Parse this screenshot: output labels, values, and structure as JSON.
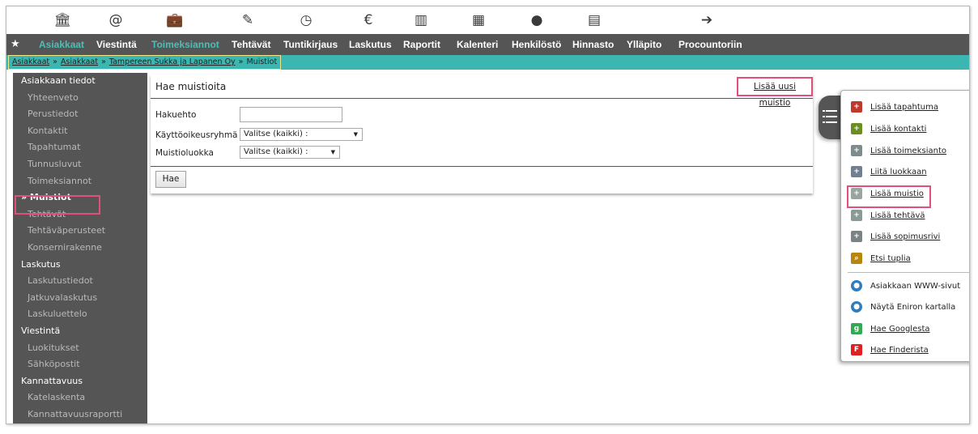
{
  "colors": {
    "accent": "#3cb6b0",
    "nav_bg": "#555555",
    "highlight_box": "#e0507a"
  },
  "icon_bar": [
    {
      "name": "bank-icon",
      "glyph": "🏛"
    },
    {
      "name": "at-icon",
      "glyph": "@"
    },
    {
      "name": "briefcase-icon",
      "glyph": "💼"
    },
    {
      "name": "edit-icon",
      "glyph": "✎"
    },
    {
      "name": "clock-icon",
      "glyph": "◷"
    },
    {
      "name": "euro-icon",
      "glyph": "€"
    },
    {
      "name": "bar-chart-icon",
      "glyph": "▥"
    },
    {
      "name": "calendar-icon",
      "glyph": "▦"
    },
    {
      "name": "person-icon",
      "glyph": "●"
    },
    {
      "name": "document-icon",
      "glyph": "▤"
    },
    {
      "name": "arrow-right-circle-icon",
      "glyph": "➔"
    }
  ],
  "nav": {
    "star": "★",
    "items": [
      "Asiakkaat",
      "Viestintä",
      "Toimeksiannot",
      "Tehtävät",
      "Tuntikirjaus",
      "Laskutus",
      "Raportit",
      "Kalenteri",
      "Henkilöstö",
      "Hinnasto",
      "Ylläpito",
      "Procountoriin"
    ]
  },
  "breadcrumb": [
    "Asiakkaat",
    "Asiakkaat",
    "Tampereen Sukka ja Lapanen Oy",
    "Muistiot"
  ],
  "breadcrumb_sep": "»",
  "sidebar": [
    {
      "type": "head",
      "label": "Asiakkaan tiedot"
    },
    {
      "type": "item",
      "label": "Yhteenveto"
    },
    {
      "type": "item",
      "label": "Perustiedot"
    },
    {
      "type": "item",
      "label": "Kontaktit"
    },
    {
      "type": "item",
      "label": "Tapahtumat"
    },
    {
      "type": "item",
      "label": "Tunnusluvut"
    },
    {
      "type": "item",
      "label": "Toimeksiannot"
    },
    {
      "type": "active",
      "label": "» Muistiot"
    },
    {
      "type": "item",
      "label": "Tehtävät"
    },
    {
      "type": "item",
      "label": "Tehtäväperusteet"
    },
    {
      "type": "item",
      "label": "Konsernirakenne"
    },
    {
      "type": "head",
      "label": "Laskutus"
    },
    {
      "type": "item",
      "label": "Laskutustiedot"
    },
    {
      "type": "item",
      "label": "Jatkuvalaskutus"
    },
    {
      "type": "item",
      "label": "Laskuluettelo"
    },
    {
      "type": "head",
      "label": "Viestintä"
    },
    {
      "type": "item",
      "label": "Luokitukset"
    },
    {
      "type": "item",
      "label": "Sähköpostit"
    },
    {
      "type": "head",
      "label": "Kannattavuus"
    },
    {
      "type": "item",
      "label": "Katelaskenta"
    },
    {
      "type": "item",
      "label": "Kannattavuusraportti"
    }
  ],
  "search": {
    "title": "Hae muistioita",
    "add_link": "Lisää uusi muistio",
    "fields": {
      "hakuehto_label": "Hakuehto",
      "hakuehto_value": "",
      "group_label": "Käyttöoikeusryhmä",
      "group_value": "Valitse (kaikki) :",
      "class_label": "Muistioluokka",
      "class_value": "Valitse (kaikki) :"
    },
    "button": "Hae"
  },
  "popup": {
    "items": [
      {
        "label": "Lisää tapahtuma",
        "icon": "calendar-add-icon",
        "color": "#c0392b",
        "glyph": "+",
        "link": true
      },
      {
        "label": "Lisää kontakti",
        "icon": "user-add-icon",
        "color": "#6b8e23",
        "glyph": "+",
        "link": true
      },
      {
        "label": "Lisää toimeksianto",
        "icon": "folder-add-icon",
        "color": "#7f8c8d",
        "glyph": "+",
        "link": true
      },
      {
        "label": "Liitä luokkaan",
        "icon": "stack-add-icon",
        "color": "#708090",
        "glyph": "+",
        "link": true
      },
      {
        "label": "Lisää muistio",
        "icon": "memo-add-icon",
        "color": "#9aa5a0",
        "glyph": "+",
        "link": true
      },
      {
        "label": "Lisää tehtävä",
        "icon": "task-add-icon",
        "color": "#8a9a96",
        "glyph": "+",
        "link": true
      },
      {
        "label": "Lisää sopimusrivi",
        "icon": "contract-add-icon",
        "color": "#7a8486",
        "glyph": "+",
        "link": true
      },
      {
        "label": "Etsi tuplia",
        "icon": "magnifier-icon",
        "color": "#b8860b",
        "glyph": "⌕",
        "link": true
      },
      {
        "label": "Asiakkaan WWW-sivut",
        "icon": "globe-icon",
        "color": "#2e7dbf",
        "glyph": "●",
        "link": false
      },
      {
        "label": "Näytä Eniron kartalla",
        "icon": "globe-pin-icon",
        "color": "#2e7dbf",
        "glyph": "●",
        "link": false
      },
      {
        "label": "Hae Googlesta",
        "icon": "google-icon",
        "color": "#34a853",
        "glyph": "g",
        "link": true
      },
      {
        "label": "Hae Finderista",
        "icon": "finder-icon",
        "color": "#e02020",
        "glyph": "F",
        "link": true
      }
    ]
  }
}
